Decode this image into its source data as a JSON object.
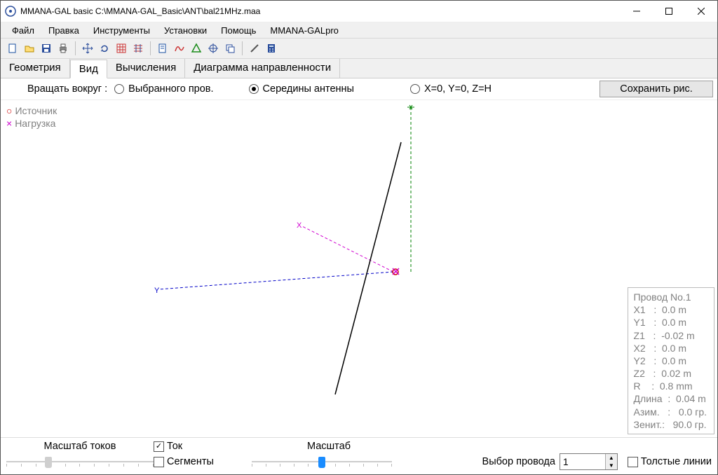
{
  "title": "MMANA-GAL basic C:\\MMANA-GAL_Basic\\ANT\\bal21MHz.maa",
  "menu": [
    "Файл",
    "Правка",
    "Инструменты",
    "Установки",
    "Помощь",
    "MMANA-GALpro"
  ],
  "toolbar_icons": [
    "new-icon",
    "open-icon",
    "save-icon",
    "print-icon",
    "sep",
    "move-icon",
    "reset-icon",
    "grid-icon",
    "align-icon",
    "sep",
    "doc-icon",
    "curve-icon",
    "triangle-icon",
    "target-icon",
    "copy-icon",
    "sep",
    "tools-icon",
    "calc-icon"
  ],
  "tabs": [
    "Геометрия",
    "Вид",
    "Вычисления",
    "Диаграмма направленности"
  ],
  "selected_tab": 1,
  "rotate_label": "Вращать вокруг :",
  "rotate_options": [
    {
      "label": "Выбранного пров.",
      "checked": false
    },
    {
      "label": "Середины антенны",
      "checked": true
    },
    {
      "label": "X=0, Y=0, Z=H",
      "checked": false
    }
  ],
  "save_image_btn": "Сохранить рис.",
  "legend": {
    "source": "Источник",
    "load": "Нагрузка"
  },
  "info": {
    "title": "Провод No.1",
    "rows": [
      "X1   :  0.0 m",
      "Y1   :  0.0 m",
      "Z1   :  -0.02 m",
      "X2   :  0.0 m",
      "Y2   :  0.0 m",
      "Z2   :  0.02 m",
      "R    :  0.8 mm",
      "Длина  :  0.04 m",
      "Азим.   :   0.0 гр.",
      "Зенит.:   90.0 гр."
    ]
  },
  "bottom": {
    "current_scale_label": "Масштаб токов",
    "scale_label": "Масштаб",
    "tok_label": "Ток",
    "segments_label": "Сегменты",
    "wire_select_label": "Выбор провода",
    "wire_select_value": "1",
    "thick_lines_label": "Толстые линии"
  }
}
